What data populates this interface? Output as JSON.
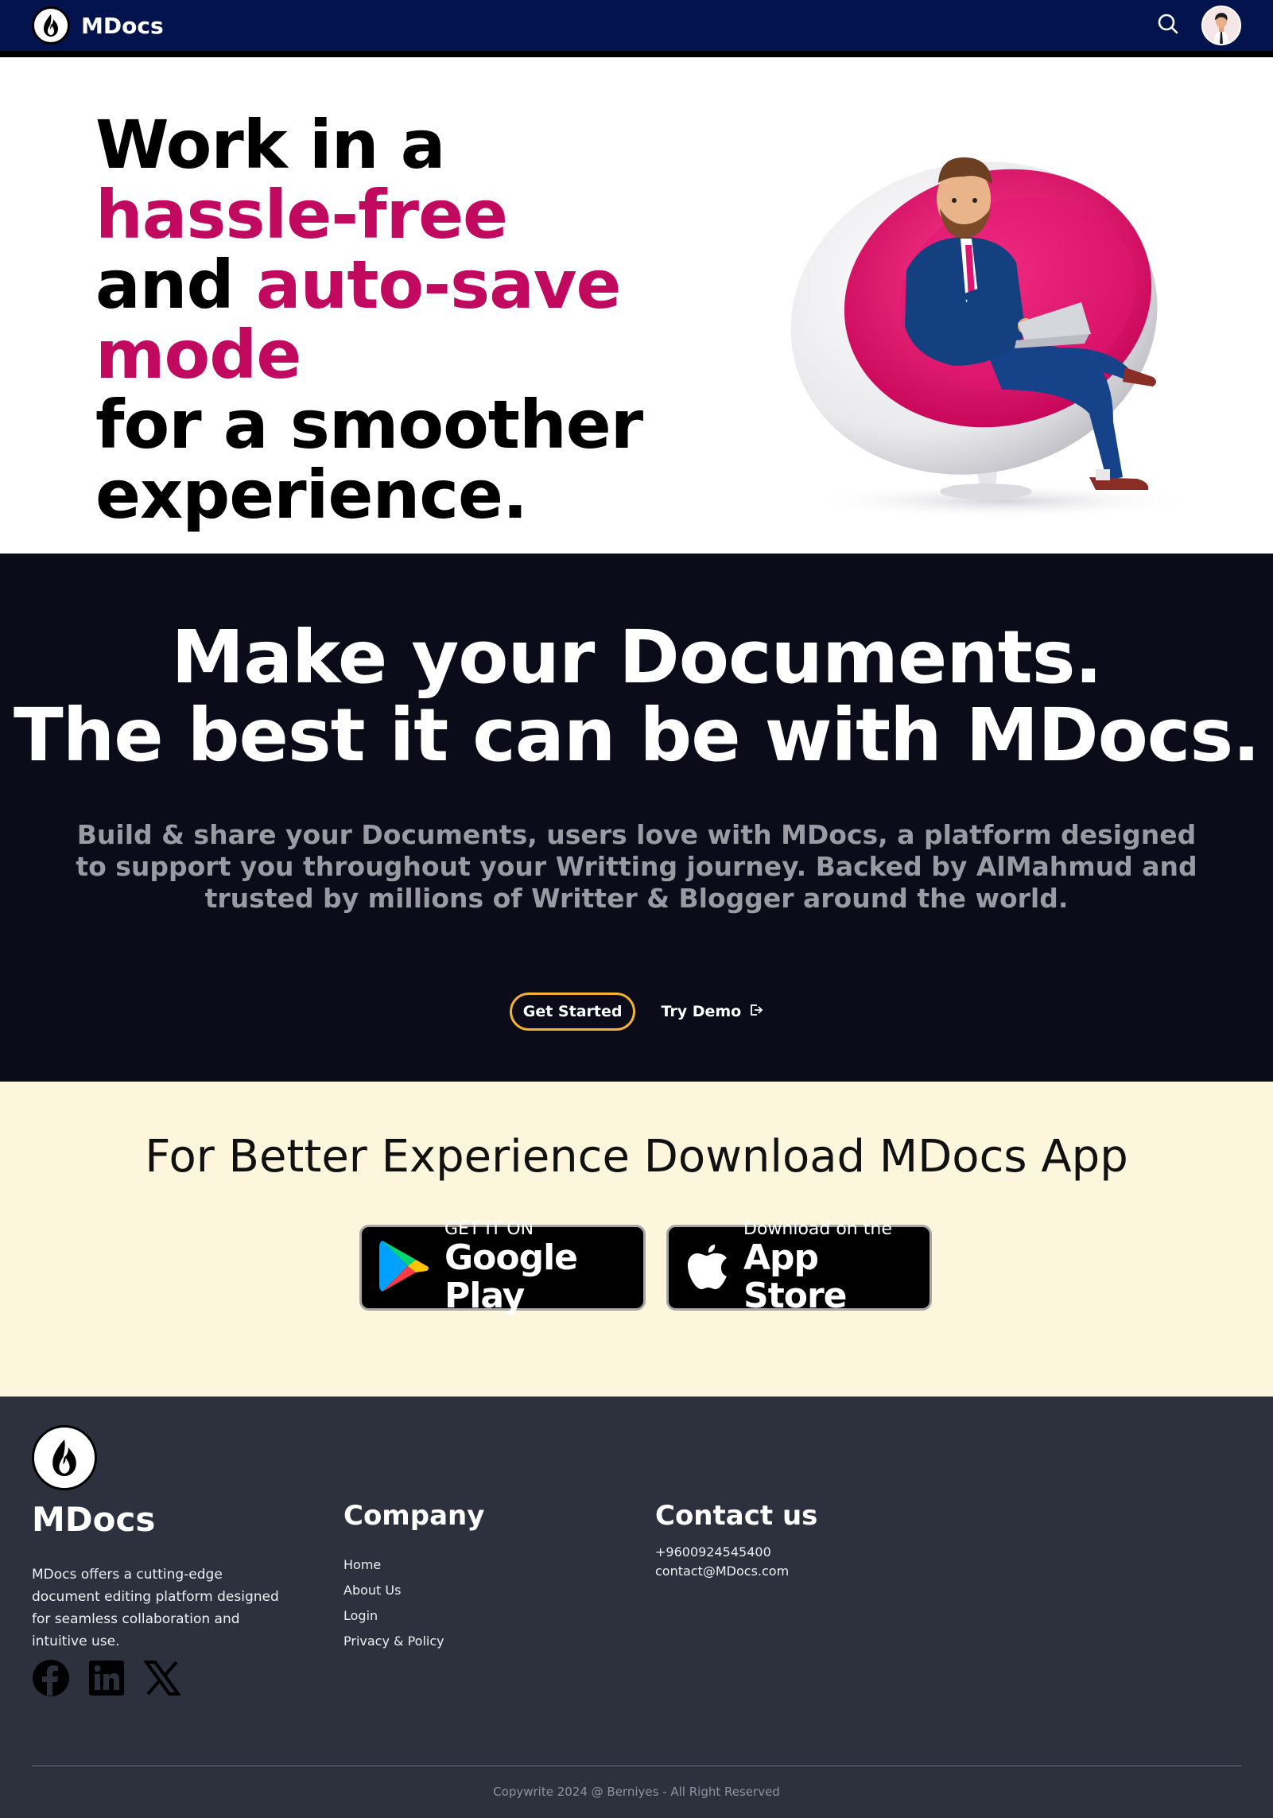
{
  "nav": {
    "brand": "MDocs",
    "icons": {
      "logo": "flame-logo-icon",
      "search": "search-icon",
      "avatar": "user-avatar-icon"
    }
  },
  "hero": {
    "line1": "Work in a",
    "line2": "hassle-free",
    "line3a": "and",
    "line3b": "auto-save",
    "line4": "mode",
    "line5": "for a smoother",
    "line6": "experience.",
    "accent_color": "#c0095f",
    "illustration": "man-in-egg-chair-with-laptop"
  },
  "promo": {
    "heading_line1": "Make your Documents.",
    "heading_line2": "The best it can be with MDocs.",
    "description": "Build & share your Documents,  users love with MDocs, a platform designed to support you throughout your Writting journey. Backed by AlMahmud and trusted by millions of Writter & Blogger around the world.",
    "get_started_label": "Get Started",
    "try_demo_label": "Try Demo",
    "button_border_color": "#f3b233"
  },
  "download": {
    "title": "For Better Experience Download MDocs App",
    "google_play": {
      "small": "GET IT ON",
      "big": "Google Play"
    },
    "app_store": {
      "small": "Download on the",
      "big": "App Store"
    }
  },
  "footer": {
    "brand": "MDocs",
    "description": "MDocs offers a cutting-edge document editing platform designed for seamless collaboration and intuitive use.",
    "socials": [
      "facebook-icon",
      "linkedin-icon",
      "x-icon"
    ],
    "company": {
      "title": "Company",
      "links": [
        "Home",
        "About Us",
        "Login",
        "Privacy & Policy"
      ]
    },
    "contact": {
      "title": "Contact us",
      "phone": "+9600924545400",
      "email": "contact@MDocs.com"
    },
    "copyright": "Copywrite 2024 @ Berniyes - All Right Reserved"
  }
}
